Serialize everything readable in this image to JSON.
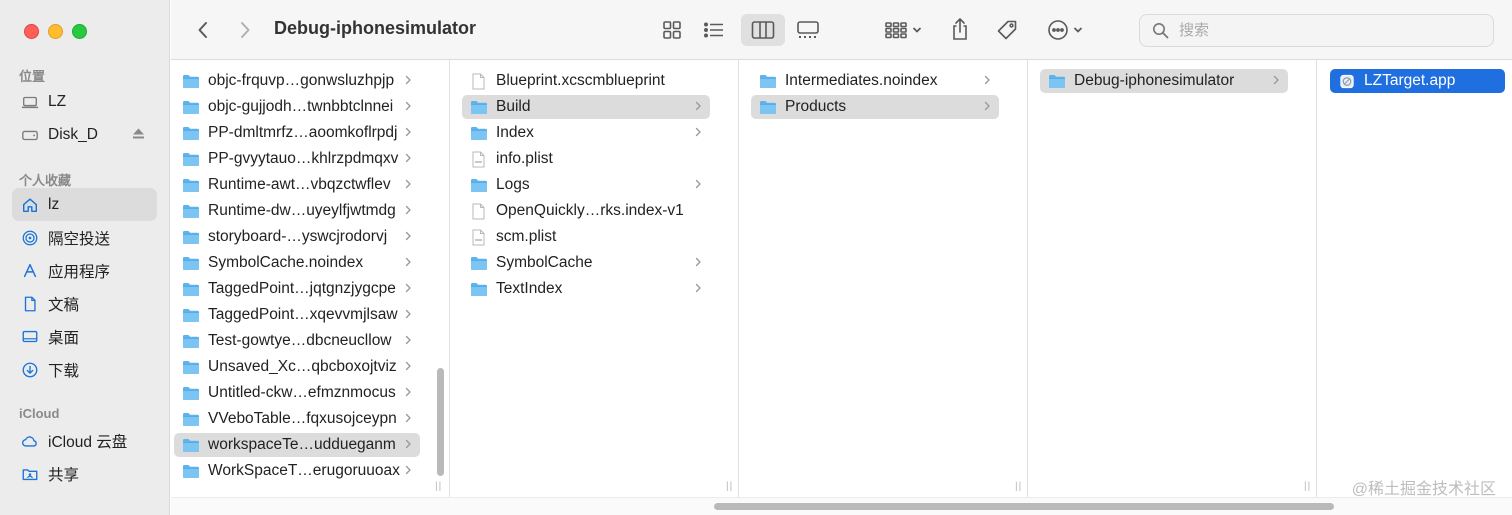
{
  "window": {
    "title": "Debug-iphonesimulator"
  },
  "search": {
    "placeholder": "搜索"
  },
  "sidebar": {
    "sections": [
      {
        "title": "位置",
        "items": [
          {
            "label": "LZ",
            "icon": "laptop-icon"
          },
          {
            "label": "Disk_D",
            "icon": "drive-icon",
            "eject": true
          }
        ]
      },
      {
        "title": "个人收藏",
        "items": [
          {
            "label": "lz",
            "icon": "home-icon",
            "selected": true
          },
          {
            "label": "隔空投送",
            "icon": "airdrop-icon"
          },
          {
            "label": "应用程序",
            "icon": "applications-icon"
          },
          {
            "label": "文稿",
            "icon": "document-icon"
          },
          {
            "label": "桌面",
            "icon": "desktop-icon"
          },
          {
            "label": "下载",
            "icon": "download-icon"
          }
        ]
      },
      {
        "title": "iCloud",
        "items": [
          {
            "label": "iCloud 云盘",
            "icon": "cloud-icon"
          },
          {
            "label": "共享",
            "icon": "shared-folder-icon"
          }
        ]
      }
    ]
  },
  "columns": {
    "col1": [
      {
        "label": "objc-frquvp…gonwsluzhpjp",
        "kind": "folder",
        "chevron": true
      },
      {
        "label": "objc-gujjodh…twnbbtclnnei",
        "kind": "folder",
        "chevron": true
      },
      {
        "label": "PP-dmltmrfz…aoomkoflrpdj",
        "kind": "folder",
        "chevron": true
      },
      {
        "label": "PP-gvyytauo…khlrzpdmqxv",
        "kind": "folder",
        "chevron": true
      },
      {
        "label": "Runtime-awt…vbqzctwflev",
        "kind": "folder",
        "chevron": true
      },
      {
        "label": "Runtime-dw…uyeylfjwtmdg",
        "kind": "folder",
        "chevron": true
      },
      {
        "label": "storyboard-…yswcjrodorvj",
        "kind": "folder",
        "chevron": true
      },
      {
        "label": "SymbolCache.noindex",
        "kind": "folder",
        "chevron": true
      },
      {
        "label": "TaggedPoint…jqtgnzjygcpe",
        "kind": "folder",
        "chevron": true
      },
      {
        "label": "TaggedPoint…xqevvmjlsaw",
        "kind": "folder",
        "chevron": true
      },
      {
        "label": "Test-gowtye…dbcneucllow",
        "kind": "folder",
        "chevron": true
      },
      {
        "label": "Unsaved_Xc…qbcboxojtviz",
        "kind": "folder",
        "chevron": true
      },
      {
        "label": "Untitled-ckw…efmznmocus",
        "kind": "folder",
        "chevron": true
      },
      {
        "label": "VVeboTable…fqxusojceypn",
        "kind": "folder",
        "chevron": true
      },
      {
        "label": "workspaceTe…uddueganm",
        "kind": "folder",
        "chevron": true,
        "selected": true
      },
      {
        "label": "WorkSpaceT…erugoruuoax",
        "kind": "folder",
        "chevron": true
      }
    ],
    "col2": [
      {
        "label": "Blueprint.xcscmblueprint",
        "kind": "file"
      },
      {
        "label": "Build",
        "kind": "folder",
        "chevron": true,
        "selected": true
      },
      {
        "label": "Index",
        "kind": "folder",
        "chevron": true
      },
      {
        "label": "info.plist",
        "kind": "plist"
      },
      {
        "label": "Logs",
        "kind": "folder",
        "chevron": true
      },
      {
        "label": "OpenQuickly…rks.index-v1",
        "kind": "file"
      },
      {
        "label": "scm.plist",
        "kind": "plist"
      },
      {
        "label": "SymbolCache",
        "kind": "folder",
        "chevron": true
      },
      {
        "label": "TextIndex",
        "kind": "folder",
        "chevron": true
      }
    ],
    "col3": [
      {
        "label": "Intermediates.noindex",
        "kind": "folder",
        "chevron": true
      },
      {
        "label": "Products",
        "kind": "folder",
        "chevron": true,
        "selected": true
      }
    ],
    "col4": [
      {
        "label": "Debug-iphonesimulator",
        "kind": "folder",
        "chevron": true,
        "selected": true
      }
    ],
    "col5": [
      {
        "label": "LZTarget.app",
        "kind": "app",
        "selected": true,
        "active": true
      }
    ]
  },
  "watermark": "@稀土掘金技术社区",
  "colors": {
    "accent": "#1f6fe0",
    "folder": "#5fb3ec"
  }
}
